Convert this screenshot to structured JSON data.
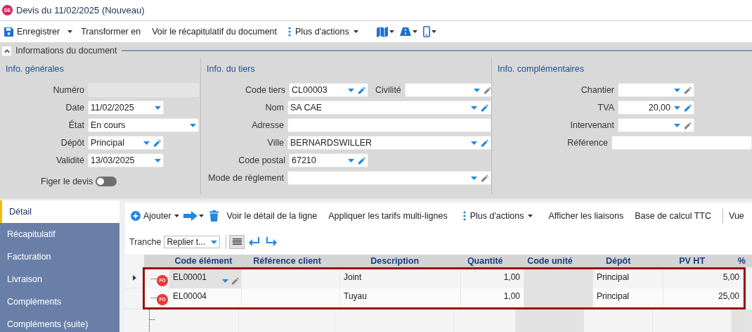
{
  "window": {
    "badge": "DE",
    "title": "Devis du 11/02/2025 (Nouveau)"
  },
  "toolbar": [
    {
      "kind": "save",
      "label": "Enregistrer"
    },
    {
      "kind": "text",
      "label": "Transformer en"
    },
    {
      "kind": "text",
      "label": "Voir le récapitulatif du document"
    },
    {
      "kind": "more",
      "label": "Plus d'actions"
    },
    {
      "kind": "map"
    },
    {
      "kind": "road"
    },
    {
      "kind": "phone"
    }
  ],
  "section": {
    "title": "Informations du document",
    "expanded": true
  },
  "groups": [
    {
      "title": "Info. générales",
      "fields": [
        {
          "label": "Numéro",
          "kind": "text",
          "disabled": true
        },
        {
          "label": "Date",
          "kind": "select",
          "value": "11/02/2025"
        },
        {
          "label": "État",
          "kind": "select",
          "value": "En cours"
        },
        {
          "label": "Dépôt",
          "kind": "select-edit",
          "value": "Principal",
          "edit_enabled": true
        },
        {
          "label": "Validité",
          "kind": "select",
          "value": "13/03/2025"
        }
      ],
      "toggle": {
        "label": "Figer le devis",
        "on": false
      }
    },
    {
      "title": "Info. du tiers",
      "fields": [
        {
          "label": "Code tiers",
          "kind": "select-edit",
          "value": "CL00003",
          "edit_enabled": true
        },
        {
          "label": "Civilité",
          "kind": "select-edit",
          "edit_enabled": false
        },
        {
          "label": "Nom",
          "kind": "select-edit",
          "value": "SA CAE",
          "edit_enabled": true
        },
        {
          "label": "Adresse",
          "kind": "text"
        },
        {
          "label": "Ville",
          "kind": "select-edit",
          "value": "BERNARDSWILLER",
          "edit_enabled": true
        },
        {
          "label": "Code postal",
          "kind": "select-edit",
          "value": "67210",
          "edit_enabled": true
        },
        {
          "label": "Mode de règlement",
          "kind": "select-edit",
          "edit_enabled": false
        }
      ]
    },
    {
      "title": "Info. complémentaires",
      "fields": [
        {
          "label": "Chantier",
          "kind": "select-edit",
          "edit_enabled": false
        },
        {
          "label": "TVA",
          "kind": "select-edit",
          "value": "20,00",
          "edit_enabled": true
        },
        {
          "label": "Intervenant",
          "kind": "select-edit",
          "edit_enabled": false
        },
        {
          "label": "Référence",
          "kind": "text"
        }
      ]
    }
  ],
  "tabs": [
    {
      "label": "Détail",
      "selected": true
    },
    {
      "label": "Récapitulatif",
      "selected": false
    },
    {
      "label": "Facturation",
      "selected": false
    },
    {
      "label": "Livraison",
      "selected": false
    },
    {
      "label": "Compléments",
      "selected": false
    },
    {
      "label": "Compléments (suite)",
      "selected": false
    }
  ],
  "detail_toolbar": [
    {
      "kind": "add",
      "label": "Ajouter"
    },
    {
      "kind": "arrow"
    },
    {
      "kind": "trash"
    },
    {
      "kind": "text",
      "label": "Voir le détail de la ligne"
    },
    {
      "kind": "text",
      "label": "Appliquer les tarifs multi-lignes"
    },
    {
      "kind": "more",
      "label": "Plus d'actions"
    },
    {
      "kind": "text",
      "label": "Afficher les liaisons"
    },
    {
      "kind": "text",
      "label": "Base de calcul TTC"
    },
    {
      "kind": "text",
      "label": "Vue"
    }
  ],
  "tranche": {
    "label": "Tranche",
    "value": "Replier t..."
  },
  "table": {
    "columns": [
      "Code élément",
      "Référence client",
      "Description",
      "Quantité",
      "Code unité",
      "Dépôt",
      "PV HT",
      "%"
    ],
    "rows": [
      {
        "selected": true,
        "badge": "FO",
        "cells": [
          "EL00001",
          "",
          "Joint",
          "1,00",
          "",
          "Principal",
          "5,00"
        ]
      },
      {
        "selected": false,
        "badge": "FO",
        "cells": [
          "EL00004",
          "",
          "Tuyau",
          "1,00",
          "",
          "Principal",
          "25,00"
        ]
      }
    ]
  }
}
